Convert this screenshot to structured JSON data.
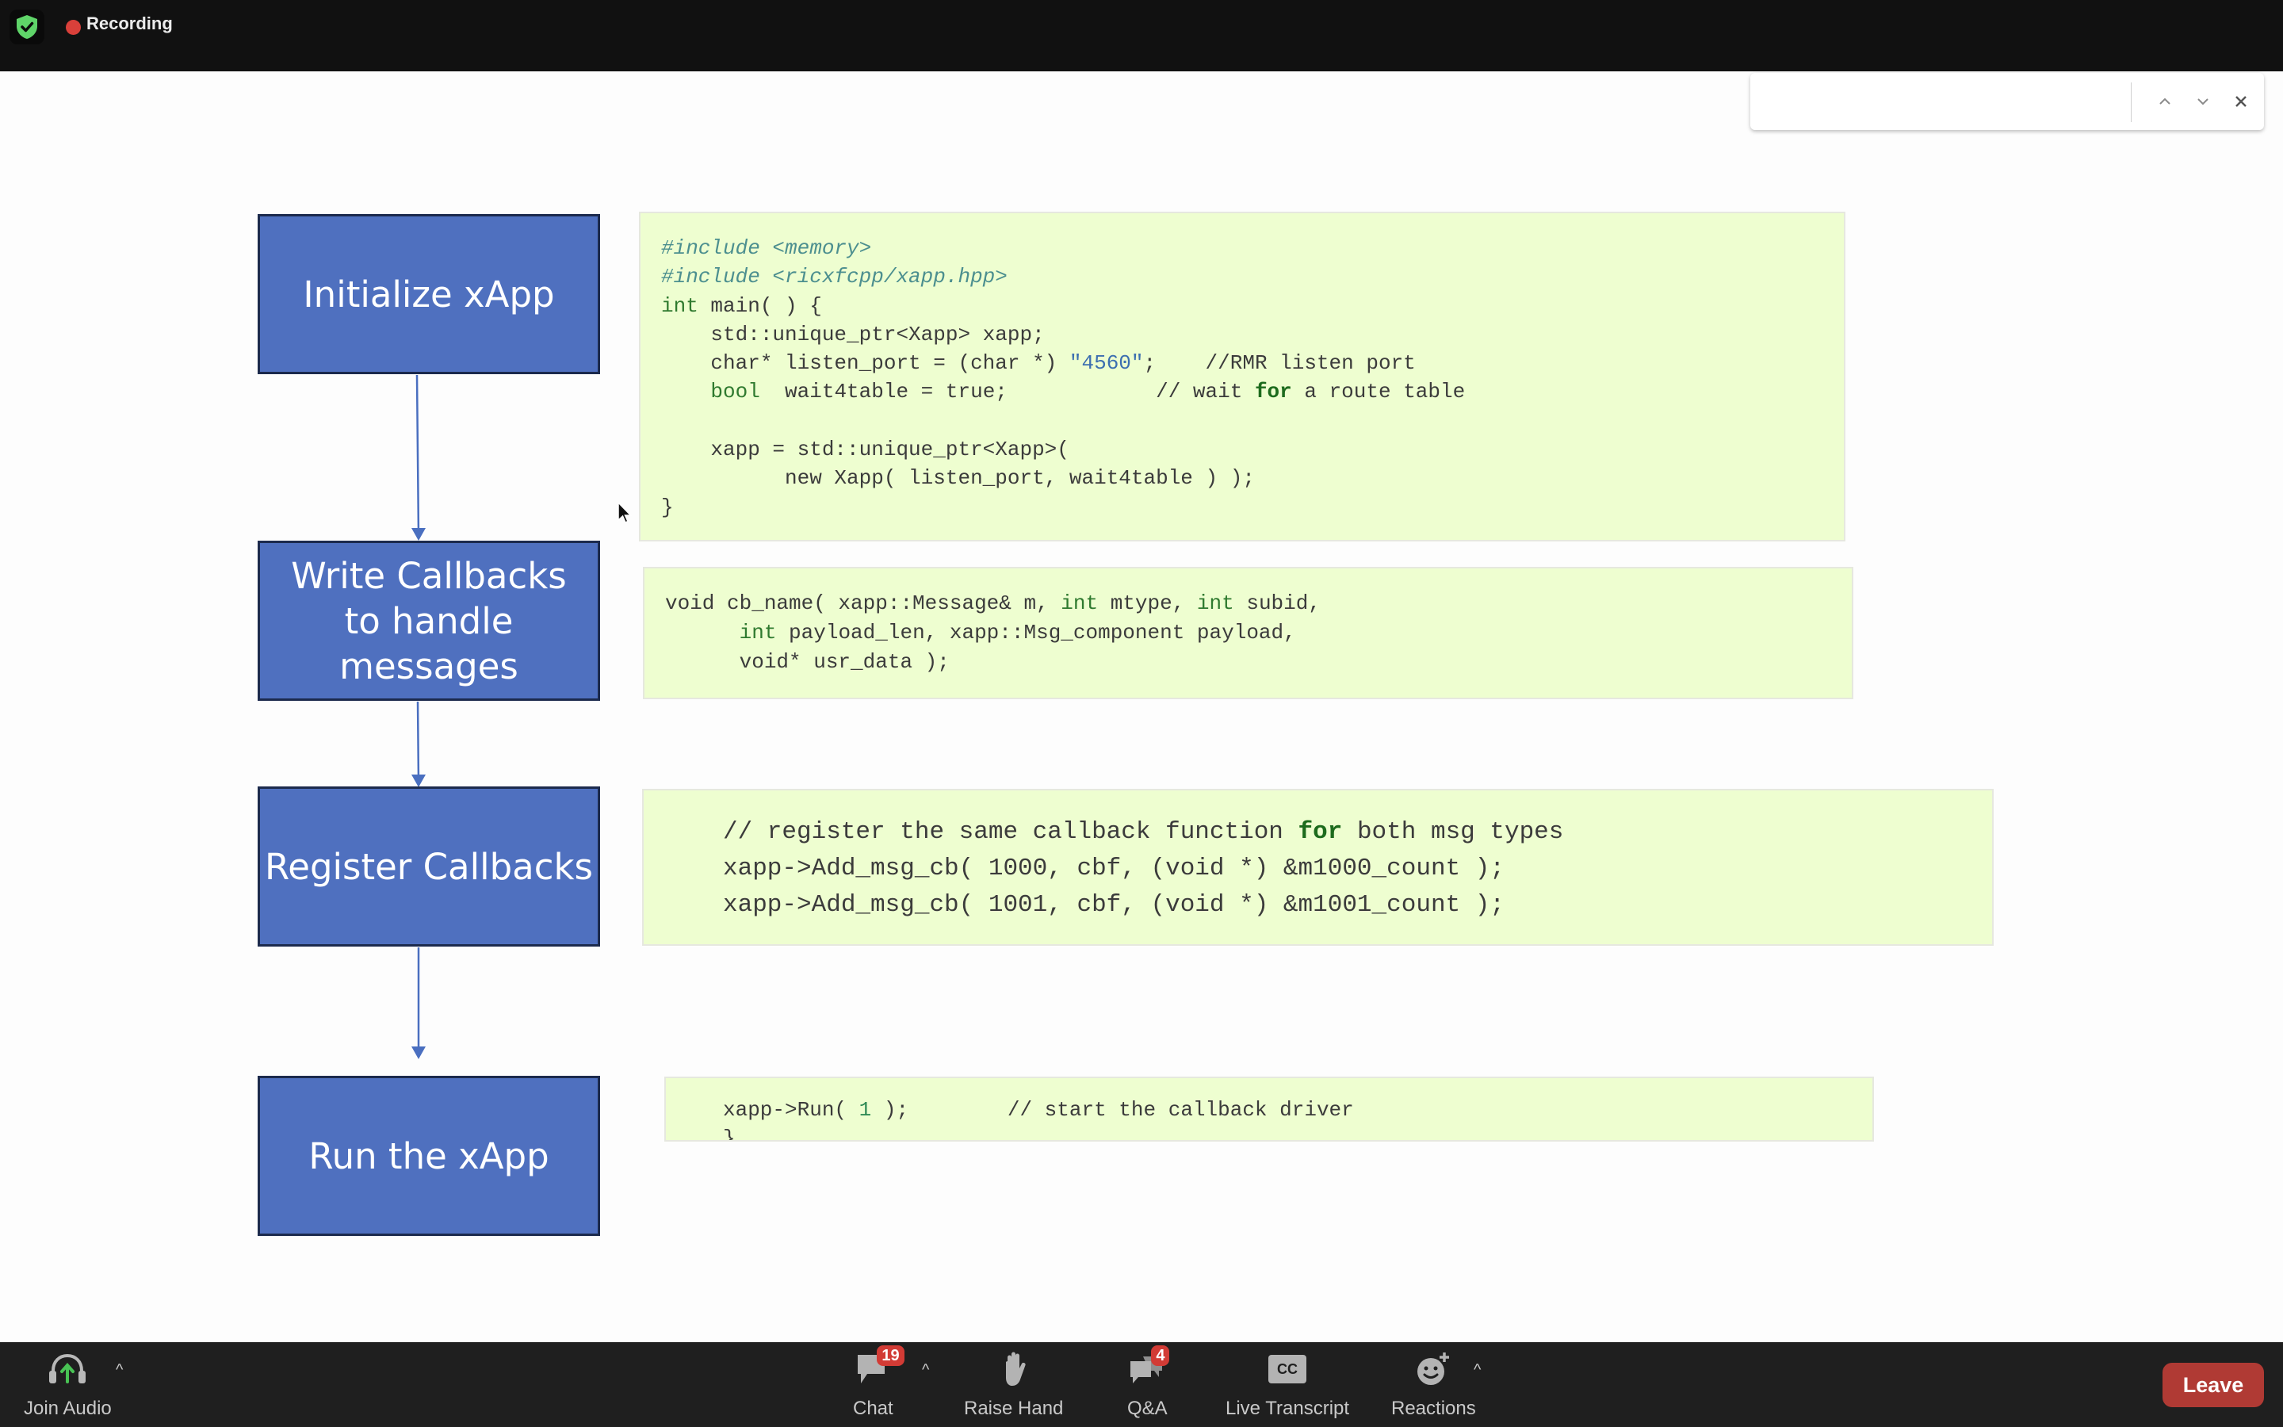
{
  "topbar": {
    "security_icon": "shield-check-icon",
    "recording_label": "Recording",
    "recording_color": "#d9403a"
  },
  "search": {
    "value": "",
    "placeholder": "",
    "prev_icon": "chevron-up-icon",
    "next_icon": "chevron-down-icon",
    "close_icon": "close-icon",
    "prev_glyph": "⌃",
    "next_glyph": "⌄",
    "close_glyph": "✕"
  },
  "slide": {
    "box_color": "#4f70bf",
    "code_bg": "#eefed0",
    "steps": [
      {
        "label": "Initialize xApp"
      },
      {
        "label": "Write Callbacks to handle messages"
      },
      {
        "label": "Register Callbacks"
      },
      {
        "label": "Run the xApp"
      }
    ],
    "code_blocks": [
      {
        "lines": [
          "#include <memory>",
          "#include <ricxfcpp/xapp.hpp>",
          "int main( ) {",
          "    std::unique_ptr<Xapp> xapp;",
          "    char* listen_port = (char *) \"4560\";    //RMR listen port",
          "    bool  wait4table = true;            // wait for a route table",
          "",
          "    xapp = std::unique_ptr<Xapp>(",
          "          new Xapp( listen_port, wait4table ) );",
          "}"
        ]
      },
      {
        "lines": [
          "void cb_name( xapp::Message& m, int mtype, int subid,",
          "      int payload_len, xapp::Msg_component payload,",
          "      void* usr_data );"
        ]
      },
      {
        "lines": [
          "// register the same callback function for both msg types",
          "xapp->Add_msg_cb( 1000, cbf, (void *) &m1000_count );",
          "xapp->Add_msg_cb( 1001, cbf, (void *) &m1001_count );"
        ]
      },
      {
        "lines": [
          "xapp->Run( 1 );        // start the callback driver",
          "}"
        ]
      }
    ]
  },
  "toolbar": {
    "join_audio": {
      "label": "Join Audio",
      "icon": "headphones-icon"
    },
    "chat": {
      "label": "Chat",
      "icon": "chat-icon",
      "badge": "19"
    },
    "raise_hand": {
      "label": "Raise Hand",
      "icon": "hand-icon"
    },
    "qa": {
      "label": "Q&A",
      "icon": "qa-icon",
      "badge": "4"
    },
    "live_transcript": {
      "label": "Live Transcript",
      "icon": "cc-icon",
      "cc_text": "CC"
    },
    "reactions": {
      "label": "Reactions",
      "icon": "smiley-plus-icon"
    },
    "caret_glyph": "^",
    "leave_label": "Leave",
    "leave_color": "#b03a34",
    "badge_color": "#d23b35"
  }
}
